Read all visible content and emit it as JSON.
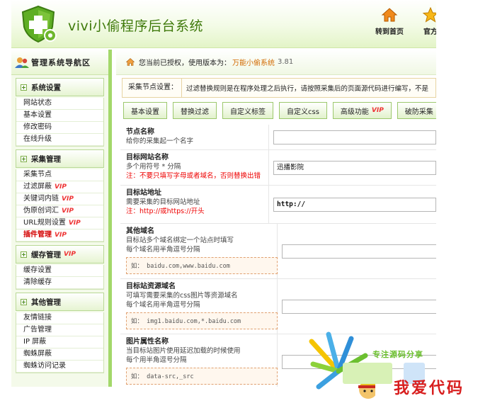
{
  "header": {
    "title": "vivi小偷程序后台系统",
    "links": [
      {
        "label": "转到首页",
        "icon": "home-icon"
      },
      {
        "label": "官方",
        "icon": "star-icon"
      }
    ]
  },
  "sidebar": {
    "title": "管理系统导航区",
    "groups": [
      {
        "label": "系统设置",
        "items": [
          "网站状态",
          "基本设置",
          "修改密码",
          "在线升级"
        ]
      },
      {
        "label": "采集管理",
        "items": [
          "采集节点",
          "过滤屏蔽",
          "关键词内链",
          "伪原创词汇",
          "URL规则设置",
          "插件管理"
        ]
      },
      {
        "label": "缓存管理",
        "items": [
          "缓存设置",
          "清除缓存"
        ]
      },
      {
        "label": "其他管理",
        "items": [
          "友情链接",
          "广告管理",
          "IP 屏蔽",
          "蜘蛛屏蔽",
          "蜘蛛访问记录"
        ]
      }
    ],
    "vip_label": "VIP"
  },
  "status": {
    "text": "您当前已授权，使用版本为：",
    "version": "万能小偷系统",
    "version_number": "3.81"
  },
  "tip": {
    "label": "采集节点设置：",
    "text": "过滤替换规则是在程序处理之后执行，请按照采集后的页面源代码进行编写，不是"
  },
  "tabs": [
    {
      "label": "基本设置",
      "vip": false
    },
    {
      "label": "替换过滤",
      "vip": false
    },
    {
      "label": "自定义标签",
      "vip": false
    },
    {
      "label": "自定义css",
      "vip": false
    },
    {
      "label": "高级功能",
      "vip": true
    },
    {
      "label": "破防采集",
      "vip": true
    }
  ],
  "form": {
    "node_name": {
      "label": "节点名称",
      "desc": "给你的采集起一个名字",
      "value": ""
    },
    "target_site_name": {
      "label": "目标网站名称",
      "desc": "多个用符号 * 分隔",
      "warn": "注：不要只填写字母或者域名，否则替换出错",
      "value": "迅播影院"
    },
    "target_site_url": {
      "label": "目标站地址",
      "desc": "需要采集的目标网站地址",
      "warn": "注：http://或https://开头",
      "value": "http://"
    },
    "other_domains": {
      "label": "其他域名",
      "desc1": "目标站多个域名绑定一个站点时填写",
      "desc2": "每个域名用半角逗号分隔",
      "example": "如： baidu.com,www.baidu.com",
      "value": ""
    },
    "resource_domain": {
      "label": "目标站资源域名",
      "desc1": "可填写需要采集的css图片等资源域名",
      "desc2": "每个域名用半角逗号分隔",
      "example": "如： img1.baidu.com,*.baidu.com",
      "value": ""
    },
    "image_attr": {
      "label": "图片属性名称",
      "desc1": "当目标站图片使用延迟加载的时候使用",
      "desc2": "每个用半角逗号分隔",
      "example": "如： data-src,_src",
      "value": ""
    }
  },
  "watermark": {
    "slogan": "专注源码分享",
    "brand": "我爱代码"
  }
}
